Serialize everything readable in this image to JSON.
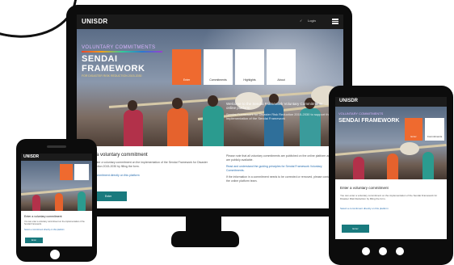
{
  "brand": {
    "logo": "UNISDR"
  },
  "desktop": {
    "header": {
      "menu_items": [
        "✓",
        "Login"
      ]
    },
    "hero": {
      "overline": "VOLUNTARY COMMITMENTS",
      "title": "SENDAI FRAMEWORK",
      "subtitle": "FOR DISASTER RISK REDUCTION 2015-2030",
      "tiles": [
        "Enter",
        "Commitments",
        "Highlights",
        "About"
      ],
      "welcome_title": "Welcome to the Sendai Framework Voluntary Commitments online platform",
      "welcome_text": "Sendai Framework for Disaster Risk Reduction 2015-2030 to support the implementation of the Sendai Framework"
    },
    "content": {
      "heading": "Enter a voluntary commitment",
      "para1": "You can enter a voluntary commitment on the implementation of the Sendai Framework for Disaster Risk Reduction 2015-2030 by filling the form.",
      "para2": "Select a commitment directly on this platform",
      "button": "Enter",
      "notes": [
        "Please note that all voluntary commitments are published on the online platform and are publicly available.",
        "Read and understand the guiding principles for Sendai Framework Voluntary Commitments.",
        "If the information in a commitment needs to be corrected or removed, please contact the online platform team."
      ]
    }
  },
  "tablet": {
    "logo": "UNISDR",
    "overline": "VOLUNTARY COMMITMENTS",
    "title": "SENDAI FRAMEWORK",
    "tiles": [
      "Enter",
      "Commitments"
    ],
    "heading": "Enter a voluntary commitment",
    "para1": "You can enter a voluntary commitment on the implementation of the Sendai Framework for Disaster Risk Reduction by filling the form.",
    "para2": "Select a commitment directly on this platform",
    "button": "Enter"
  },
  "phone": {
    "logo": "UNISDR",
    "heading": "Enter a voluntary commitment",
    "para1": "You can enter a voluntary commitment on the implementation of the Sendai Framework.",
    "para2": "Select a commitment directly on this platform",
    "button": "Enter"
  }
}
